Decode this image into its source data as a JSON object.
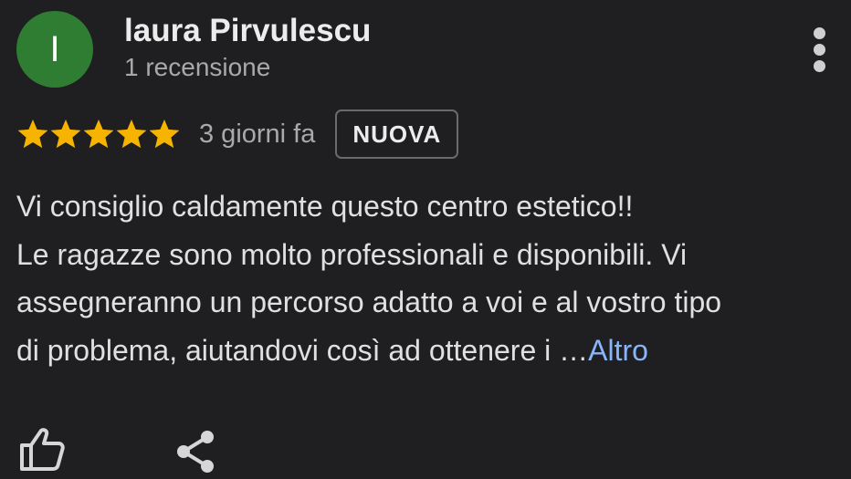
{
  "author": {
    "initial": "I",
    "name": "laura Pirvulescu",
    "meta": "1 recensione",
    "avatar_color": "#2e7d32"
  },
  "rating": {
    "stars": 5,
    "max_stars": 5,
    "star_color": "#f6b400"
  },
  "review": {
    "date": "3 giorni fa",
    "badge": "NUOVA",
    "lines": [
      "Vi consiglio caldamente questo centro estetico!!",
      "Le ragazze sono molto professionali e disponibili. Vi",
      "assegneranno un percorso adatto a voi e al vostro tipo",
      "di problema, aiutandovi così ad ottenere i …"
    ],
    "more_label": "Altro",
    "link_color": "#8ab4f8"
  },
  "icons": {
    "menu": "more-vert-icon",
    "like": "thumb-up-icon",
    "share": "share-icon"
  }
}
